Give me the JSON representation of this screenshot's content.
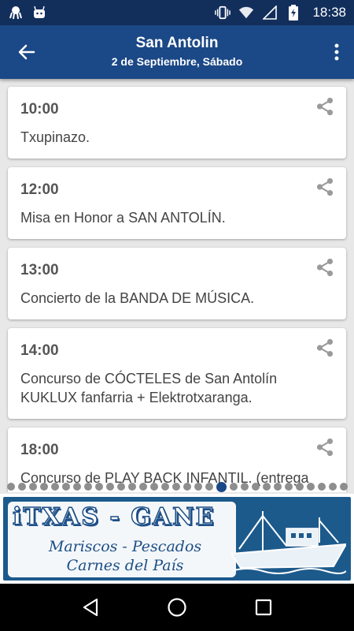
{
  "status_bar": {
    "time": "18:38",
    "left_icons": [
      "octopus-notification-icon",
      "android-notification-icon"
    ],
    "right_icons": [
      "vibrate-icon",
      "wifi-icon",
      "signal-icon",
      "battery-charging-icon"
    ]
  },
  "app_bar": {
    "title": "San Antolin",
    "subtitle": "2 de Septiembre, Sábado",
    "back_icon": "arrow-left-icon",
    "menu_icon": "more-vert-icon"
  },
  "events": [
    {
      "time": "10:00",
      "description": "Txupinazo."
    },
    {
      "time": "12:00",
      "description": "Misa en Honor a SAN ANTOLÍN."
    },
    {
      "time": "13:00",
      "description": "Concierto de la BANDA DE MÚSICA."
    },
    {
      "time": "14:00",
      "description": "Concurso de CÓCTELES de San Antolín KUKLUX fanfarria + Elektrotxaranga."
    },
    {
      "time": "18:00",
      "description": "Concurso de PLAY BACK INFANTIL. (entrega"
    }
  ],
  "pager": {
    "total": 31,
    "active_index": 19
  },
  "banner": {
    "title": "iTXAS - GANE",
    "line1": "Mariscos - Pescados",
    "line2": "Carnes del País"
  },
  "colors": {
    "status_bar": "#122f5c",
    "app_bar": "#1b4886",
    "banner_blue": "#1c4e86",
    "background": "#e8e8e8"
  }
}
